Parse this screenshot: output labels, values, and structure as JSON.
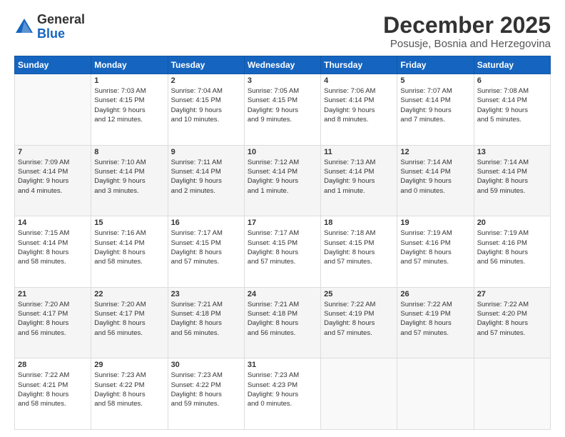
{
  "header": {
    "logo_general": "General",
    "logo_blue": "Blue",
    "month_year": "December 2025",
    "location": "Posusje, Bosnia and Herzegovina"
  },
  "weekdays": [
    "Sunday",
    "Monday",
    "Tuesday",
    "Wednesday",
    "Thursday",
    "Friday",
    "Saturday"
  ],
  "weeks": [
    [
      {
        "day": "",
        "info": ""
      },
      {
        "day": "1",
        "info": "Sunrise: 7:03 AM\nSunset: 4:15 PM\nDaylight: 9 hours\nand 12 minutes."
      },
      {
        "day": "2",
        "info": "Sunrise: 7:04 AM\nSunset: 4:15 PM\nDaylight: 9 hours\nand 10 minutes."
      },
      {
        "day": "3",
        "info": "Sunrise: 7:05 AM\nSunset: 4:15 PM\nDaylight: 9 hours\nand 9 minutes."
      },
      {
        "day": "4",
        "info": "Sunrise: 7:06 AM\nSunset: 4:14 PM\nDaylight: 9 hours\nand 8 minutes."
      },
      {
        "day": "5",
        "info": "Sunrise: 7:07 AM\nSunset: 4:14 PM\nDaylight: 9 hours\nand 7 minutes."
      },
      {
        "day": "6",
        "info": "Sunrise: 7:08 AM\nSunset: 4:14 PM\nDaylight: 9 hours\nand 5 minutes."
      }
    ],
    [
      {
        "day": "7",
        "info": "Sunrise: 7:09 AM\nSunset: 4:14 PM\nDaylight: 9 hours\nand 4 minutes."
      },
      {
        "day": "8",
        "info": "Sunrise: 7:10 AM\nSunset: 4:14 PM\nDaylight: 9 hours\nand 3 minutes."
      },
      {
        "day": "9",
        "info": "Sunrise: 7:11 AM\nSunset: 4:14 PM\nDaylight: 9 hours\nand 2 minutes."
      },
      {
        "day": "10",
        "info": "Sunrise: 7:12 AM\nSunset: 4:14 PM\nDaylight: 9 hours\nand 1 minute."
      },
      {
        "day": "11",
        "info": "Sunrise: 7:13 AM\nSunset: 4:14 PM\nDaylight: 9 hours\nand 1 minute."
      },
      {
        "day": "12",
        "info": "Sunrise: 7:14 AM\nSunset: 4:14 PM\nDaylight: 9 hours\nand 0 minutes."
      },
      {
        "day": "13",
        "info": "Sunrise: 7:14 AM\nSunset: 4:14 PM\nDaylight: 8 hours\nand 59 minutes."
      }
    ],
    [
      {
        "day": "14",
        "info": "Sunrise: 7:15 AM\nSunset: 4:14 PM\nDaylight: 8 hours\nand 58 minutes."
      },
      {
        "day": "15",
        "info": "Sunrise: 7:16 AM\nSunset: 4:14 PM\nDaylight: 8 hours\nand 58 minutes."
      },
      {
        "day": "16",
        "info": "Sunrise: 7:17 AM\nSunset: 4:15 PM\nDaylight: 8 hours\nand 57 minutes."
      },
      {
        "day": "17",
        "info": "Sunrise: 7:17 AM\nSunset: 4:15 PM\nDaylight: 8 hours\nand 57 minutes."
      },
      {
        "day": "18",
        "info": "Sunrise: 7:18 AM\nSunset: 4:15 PM\nDaylight: 8 hours\nand 57 minutes."
      },
      {
        "day": "19",
        "info": "Sunrise: 7:19 AM\nSunset: 4:16 PM\nDaylight: 8 hours\nand 57 minutes."
      },
      {
        "day": "20",
        "info": "Sunrise: 7:19 AM\nSunset: 4:16 PM\nDaylight: 8 hours\nand 56 minutes."
      }
    ],
    [
      {
        "day": "21",
        "info": "Sunrise: 7:20 AM\nSunset: 4:17 PM\nDaylight: 8 hours\nand 56 minutes."
      },
      {
        "day": "22",
        "info": "Sunrise: 7:20 AM\nSunset: 4:17 PM\nDaylight: 8 hours\nand 56 minutes."
      },
      {
        "day": "23",
        "info": "Sunrise: 7:21 AM\nSunset: 4:18 PM\nDaylight: 8 hours\nand 56 minutes."
      },
      {
        "day": "24",
        "info": "Sunrise: 7:21 AM\nSunset: 4:18 PM\nDaylight: 8 hours\nand 56 minutes."
      },
      {
        "day": "25",
        "info": "Sunrise: 7:22 AM\nSunset: 4:19 PM\nDaylight: 8 hours\nand 57 minutes."
      },
      {
        "day": "26",
        "info": "Sunrise: 7:22 AM\nSunset: 4:19 PM\nDaylight: 8 hours\nand 57 minutes."
      },
      {
        "day": "27",
        "info": "Sunrise: 7:22 AM\nSunset: 4:20 PM\nDaylight: 8 hours\nand 57 minutes."
      }
    ],
    [
      {
        "day": "28",
        "info": "Sunrise: 7:22 AM\nSunset: 4:21 PM\nDaylight: 8 hours\nand 58 minutes."
      },
      {
        "day": "29",
        "info": "Sunrise: 7:23 AM\nSunset: 4:22 PM\nDaylight: 8 hours\nand 58 minutes."
      },
      {
        "day": "30",
        "info": "Sunrise: 7:23 AM\nSunset: 4:22 PM\nDaylight: 8 hours\nand 59 minutes."
      },
      {
        "day": "31",
        "info": "Sunrise: 7:23 AM\nSunset: 4:23 PM\nDaylight: 9 hours\nand 0 minutes."
      },
      {
        "day": "",
        "info": ""
      },
      {
        "day": "",
        "info": ""
      },
      {
        "day": "",
        "info": ""
      }
    ]
  ]
}
